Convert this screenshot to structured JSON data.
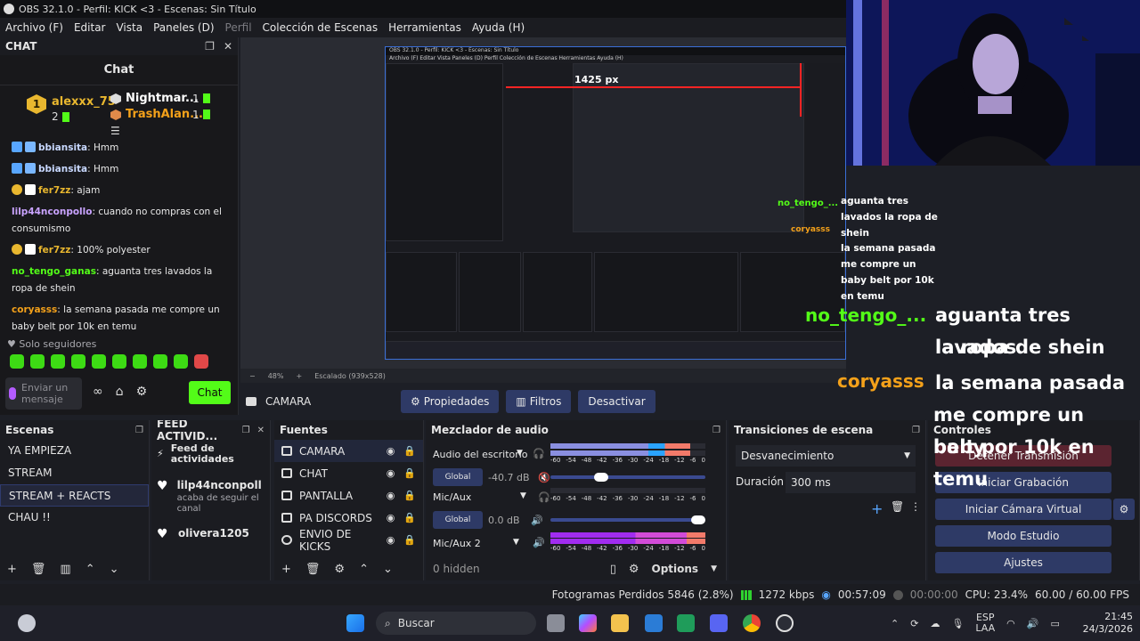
{
  "window": {
    "title": "OBS 32.1.0 - Perfil: KICK <3 - Escenas: Sin Título",
    "menu": [
      {
        "label": "Archivo (F)",
        "disabled": false
      },
      {
        "label": "Editar",
        "disabled": false
      },
      {
        "label": "Vista",
        "disabled": false
      },
      {
        "label": "Paneles (D)",
        "disabled": false
      },
      {
        "label": "Perfil",
        "disabled": true
      },
      {
        "label": "Colección de Escenas",
        "disabled": false
      },
      {
        "label": "Herramientas",
        "disabled": false
      },
      {
        "label": "Ayuda (H)",
        "disabled": false
      }
    ]
  },
  "chat": {
    "dock_title": "CHAT",
    "header": "Chat",
    "leaderboard": {
      "first": {
        "rank": "1",
        "name": "alexxx_75",
        "count": "2",
        "color": "#e9b72f"
      },
      "second": {
        "name": "Nightmar...",
        "count": "1"
      },
      "third": {
        "name": "TrashAlan...",
        "count": "1"
      }
    },
    "messages": [
      {
        "user": "bbiansita",
        "text": ": Hmm",
        "color": "#58a6ff"
      },
      {
        "user": "bbiansita",
        "text": ": Hmm",
        "color": "#58a6ff"
      },
      {
        "user": "fer7zz",
        "text": ": ajam",
        "color": "#e9b72f"
      },
      {
        "user": "lilp44nconpollo",
        "text": ": cuando no compras con el consumismo",
        "color": "#c9a3ff"
      },
      {
        "user": "fer7zz",
        "text": ": 100% polyester",
        "color": "#e9b72f"
      },
      {
        "user": "no_tengo_ganas",
        "text": ": aguanta tres lavados la ropa de shein",
        "color": "#53fc18"
      },
      {
        "user": "coryasss",
        "text": ": la semana pasada me compre un baby belt por 10k en temu",
        "color": "#f4a11a"
      }
    ],
    "followers_only": "Solo seguidores",
    "input_placeholder": "Enviar un mensaje",
    "send_label": "Chat"
  },
  "preview": {
    "zoom": "48%",
    "scale_label": "Escalado (939x528)",
    "nested_overlay": "1425 px"
  },
  "source_toolbar": {
    "source_name": "CAMARA",
    "properties": "Propiedades",
    "filters": "Filtros",
    "deactivate": "Desactivar"
  },
  "scenes": {
    "title": "Escenas",
    "items": [
      "YA EMPIEZA",
      "STREAM",
      "STREAM + REACTS",
      "CHAU !!"
    ],
    "selected": 2
  },
  "feed": {
    "title": "FEED ACTIVID...",
    "header": "Feed de actividades",
    "items": [
      {
        "name": "lilp44nconpoll",
        "sub": "acaba de seguir el canal"
      },
      {
        "name": "olivera1205",
        "sub": ""
      }
    ]
  },
  "sources": {
    "title": "Fuentes",
    "items": [
      {
        "name": "CAMARA",
        "icon": "camera-icon"
      },
      {
        "name": "CHAT",
        "icon": "window-icon"
      },
      {
        "name": "PANTALLA",
        "icon": "monitor-icon"
      },
      {
        "name": "PA DISCORDS",
        "icon": "window-icon"
      },
      {
        "name": "ENVIO DE KICKS",
        "icon": "globe-icon"
      }
    ]
  },
  "mixer": {
    "title": "Mezclador de audio",
    "channels": [
      {
        "name": "Audio del escritorio",
        "db": "-40.7 dB",
        "global": "Global",
        "level": 0.33
      },
      {
        "name": "Mic/Aux",
        "db": "0.0 dB",
        "global": "Global",
        "level": 0.97
      },
      {
        "name": "Mic/Aux 2",
        "db": "",
        "global": "",
        "level": 0
      }
    ],
    "scale": [
      "-60",
      "-54",
      "-48",
      "-42",
      "-36",
      "-30",
      "-24",
      "-18",
      "-12",
      "-6",
      "0"
    ],
    "hidden": "0 hidden",
    "options": "Options"
  },
  "transitions": {
    "title": "Transiciones de escena",
    "selected": "Desvanecimiento",
    "duration_label": "Duración",
    "duration_value": "300 ms"
  },
  "controls": {
    "title": "Controles",
    "buttons": [
      "Detener Transmisión",
      "Iniciar Grabación",
      "Iniciar Cámara Virtual",
      "Modo Estudio",
      "Ajustes"
    ]
  },
  "status": {
    "dropped": "Fotogramas Perdidos 5846 (2.8%)",
    "bitrate": "1272 kbps",
    "stream_time": "00:57:09",
    "rec_time": "00:00:00",
    "cpu": "CPU: 23.4%",
    "fps": "60.00 / 60.00 FPS"
  },
  "taskbar": {
    "search": "Buscar",
    "lang1": "ESP",
    "lang2": "LAA",
    "time": "21:45",
    "date": "24/3/2026"
  },
  "overlay": {
    "small_user": "no_tengo_...",
    "small_text": "aguanta tres lavados la ropa de shein",
    "small_user2": "coryasss",
    "small_text2": "la semana pasada me compre un baby belt por 10k en temu",
    "user1": "no_tengo_...",
    "line1a": "aguanta tres lavados",
    "line1b": "la ropa de shein",
    "user2": "coryasss",
    "line2a": "la semana pasada",
    "line2b": "me compre un baby",
    "line2c": "belt por 10k en temu"
  }
}
